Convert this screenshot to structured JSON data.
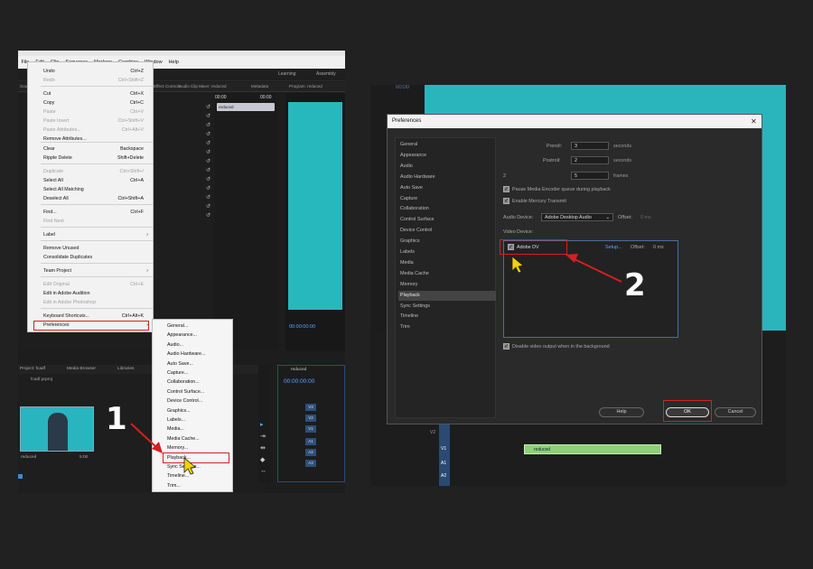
{
  "left": {
    "menubar": [
      "File",
      "Edit",
      "Clip",
      "Sequence",
      "Markers",
      "Graphics",
      "Window",
      "Help"
    ],
    "workspaces": [
      "Learning",
      "Assembly"
    ],
    "panel_headers": [
      "Source",
      "Effect Controls",
      "Audio Clip Mixer: reduced",
      "Metadata",
      "Program: reduced"
    ],
    "mini_timeline": {
      "time_start": "00:00",
      "time_end": "00:00",
      "clip": "reduced"
    },
    "program_time": "00:00:00:00",
    "project_tabs": [
      "Project: fcadf",
      "Media Browser",
      "Libraries"
    ],
    "project_file": "fcadf.prproj",
    "thumb_label": "reduced",
    "thumb_duration": "5:00",
    "seq_name": "reduced",
    "seq_time": "00:00:00:00",
    "tracks": [
      "V3",
      "V2",
      "V1",
      "A1",
      "A2",
      "A3"
    ],
    "edit_menu": [
      {
        "label": "Undo",
        "shortcut": "Ctrl+Z",
        "disabled": false
      },
      {
        "label": "Redo",
        "shortcut": "Ctrl+Shift+Z",
        "disabled": true
      },
      {
        "label": "Cut",
        "shortcut": "Ctrl+X",
        "disabled": false
      },
      {
        "label": "Copy",
        "shortcut": "Ctrl+C",
        "disabled": false
      },
      {
        "label": "Paste",
        "shortcut": "Ctrl+V",
        "disabled": true
      },
      {
        "label": "Paste Insert",
        "shortcut": "Ctrl+Shift+V",
        "disabled": true
      },
      {
        "label": "Paste Attributes...",
        "shortcut": "Ctrl+Alt+V",
        "disabled": true
      },
      {
        "label": "Remove Attributes...",
        "shortcut": "",
        "disabled": false
      },
      {
        "label": "Clear",
        "shortcut": "Backspace",
        "disabled": false
      },
      {
        "label": "Ripple Delete",
        "shortcut": "Shift+Delete",
        "disabled": false
      },
      {
        "label": "Duplicate",
        "shortcut": "Ctrl+Shift+/",
        "disabled": true
      },
      {
        "label": "Select All",
        "shortcut": "Ctrl+A",
        "disabled": false
      },
      {
        "label": "Select All Matching",
        "shortcut": "",
        "disabled": false
      },
      {
        "label": "Deselect All",
        "shortcut": "Ctrl+Shift+A",
        "disabled": false
      },
      {
        "label": "Find...",
        "shortcut": "Ctrl+F",
        "disabled": false
      },
      {
        "label": "Find Next",
        "shortcut": "",
        "disabled": true
      },
      {
        "label": "Label",
        "shortcut": "",
        "disabled": false
      },
      {
        "label": "Remove Unused",
        "shortcut": "",
        "disabled": false
      },
      {
        "label": "Consolidate Duplicates",
        "shortcut": "",
        "disabled": false
      },
      {
        "label": "Team Project",
        "shortcut": "",
        "disabled": false
      },
      {
        "label": "Edit Original",
        "shortcut": "Ctrl+E",
        "disabled": true
      },
      {
        "label": "Edit in Adobe Audition",
        "shortcut": "",
        "disabled": false
      },
      {
        "label": "Edit in Adobe Photoshop",
        "shortcut": "",
        "disabled": true
      },
      {
        "label": "Keyboard Shortcuts...",
        "shortcut": "Ctrl+Alt+K",
        "disabled": false
      },
      {
        "label": "Preferences",
        "shortcut": "",
        "disabled": false
      }
    ],
    "pref_submenu": [
      "General...",
      "Appearance...",
      "Audio...",
      "Audio Hardware...",
      "Auto Save...",
      "Capture...",
      "Collaboration...",
      "Control Surface...",
      "Device Control...",
      "Graphics...",
      "Labels...",
      "Media...",
      "Media Cache...",
      "Memory...",
      "Playback...",
      "Sync Settings...",
      "Timeline...",
      "Trim..."
    ],
    "step_label": "1"
  },
  "right": {
    "top_time": "00:00",
    "dialog_title": "Preferences",
    "nav": [
      "General",
      "Appearance",
      "Audio",
      "Audio Hardware",
      "Auto Save",
      "Capture",
      "Collaboration",
      "Control Surface",
      "Device Control",
      "Graphics",
      "Labels",
      "Media",
      "Media Cache",
      "Memory",
      "Playback",
      "Sync Settings",
      "Timeline",
      "Trim"
    ],
    "selected_nav": "Playback",
    "preroll_label": "Preroll:",
    "preroll_value": "3",
    "postroll_label": "Postroll:",
    "postroll_value": "2",
    "seconds_unit": "seconds",
    "step_label": "2",
    "step_value": "5",
    "frames_unit": "frames",
    "pause_encoder": "Pause Media Encoder queue during playback",
    "enable_mercury": "Enable Mercury Transmit",
    "audio_device_label": "Audio Device:",
    "audio_device_value": "Adobe Desktop Audio",
    "audio_offset_label": "Offset:",
    "audio_offset_value": "0 ms",
    "video_device_label": "Video Device:",
    "device_name": "Adobe DV",
    "setup_link": "Setup...",
    "device_offset_label": "Offset:",
    "device_offset_value": "0 ms",
    "disable_output": "Disable video output when in the background",
    "help_btn": "Help",
    "ok_btn": "OK",
    "cancel_btn": "Cancel",
    "clip_name": "reduced",
    "tracks": [
      "V3",
      "V2",
      "V1",
      "A1",
      "A2"
    ]
  },
  "colors": {
    "accent_red": "#d42020",
    "teal_video": "#2ab5bd",
    "clip_green": "#8fcf7a",
    "timecode_blue": "#5aa7ff"
  }
}
